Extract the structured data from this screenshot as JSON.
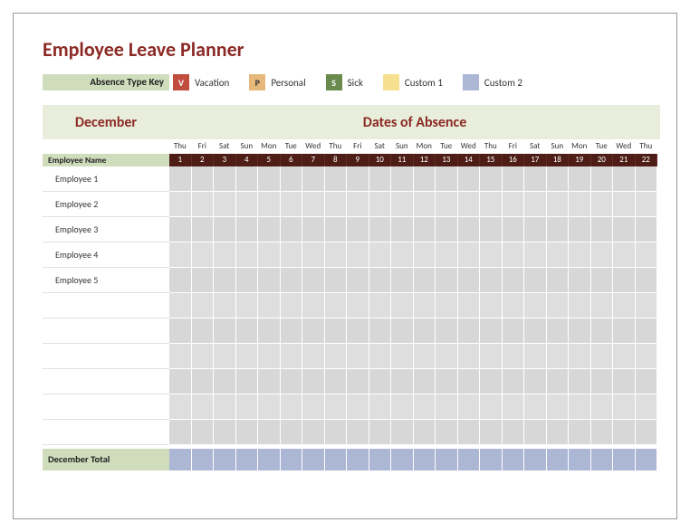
{
  "title": "Employee Leave Planner",
  "legend": {
    "key_label": "Absence Type Key",
    "items": [
      {
        "code": "V",
        "label": "Vacation",
        "cls": "v"
      },
      {
        "code": "P",
        "label": "Personal",
        "cls": "p"
      },
      {
        "code": "S",
        "label": "Sick",
        "cls": "s"
      },
      {
        "code": "",
        "label": "Custom 1",
        "cls": "c1"
      },
      {
        "code": "",
        "label": "Custom 2",
        "cls": "c2"
      }
    ]
  },
  "banner": {
    "month": "December",
    "dates_title": "Dates of Absence"
  },
  "headers": {
    "employee_name": "Employee Name"
  },
  "days": [
    {
      "dow": "Thu",
      "num": "1"
    },
    {
      "dow": "Fri",
      "num": "2"
    },
    {
      "dow": "Sat",
      "num": "3"
    },
    {
      "dow": "Sun",
      "num": "4"
    },
    {
      "dow": "Mon",
      "num": "5"
    },
    {
      "dow": "Tue",
      "num": "6"
    },
    {
      "dow": "Wed",
      "num": "7"
    },
    {
      "dow": "Thu",
      "num": "8"
    },
    {
      "dow": "Fri",
      "num": "9"
    },
    {
      "dow": "Sat",
      "num": "10"
    },
    {
      "dow": "Sun",
      "num": "11"
    },
    {
      "dow": "Mon",
      "num": "12"
    },
    {
      "dow": "Tue",
      "num": "13"
    },
    {
      "dow": "Wed",
      "num": "14"
    },
    {
      "dow": "Thu",
      "num": "15"
    },
    {
      "dow": "Fri",
      "num": "16"
    },
    {
      "dow": "Sat",
      "num": "17"
    },
    {
      "dow": "Sun",
      "num": "18"
    },
    {
      "dow": "Mon",
      "num": "19"
    },
    {
      "dow": "Tue",
      "num": "20"
    },
    {
      "dow": "Wed",
      "num": "21"
    },
    {
      "dow": "Thu",
      "num": "22"
    }
  ],
  "employees": [
    "Employee 1",
    "Employee 2",
    "Employee 3",
    "Employee 4",
    "Employee 5",
    "",
    "",
    "",
    "",
    "",
    ""
  ],
  "total_label": "December Total"
}
